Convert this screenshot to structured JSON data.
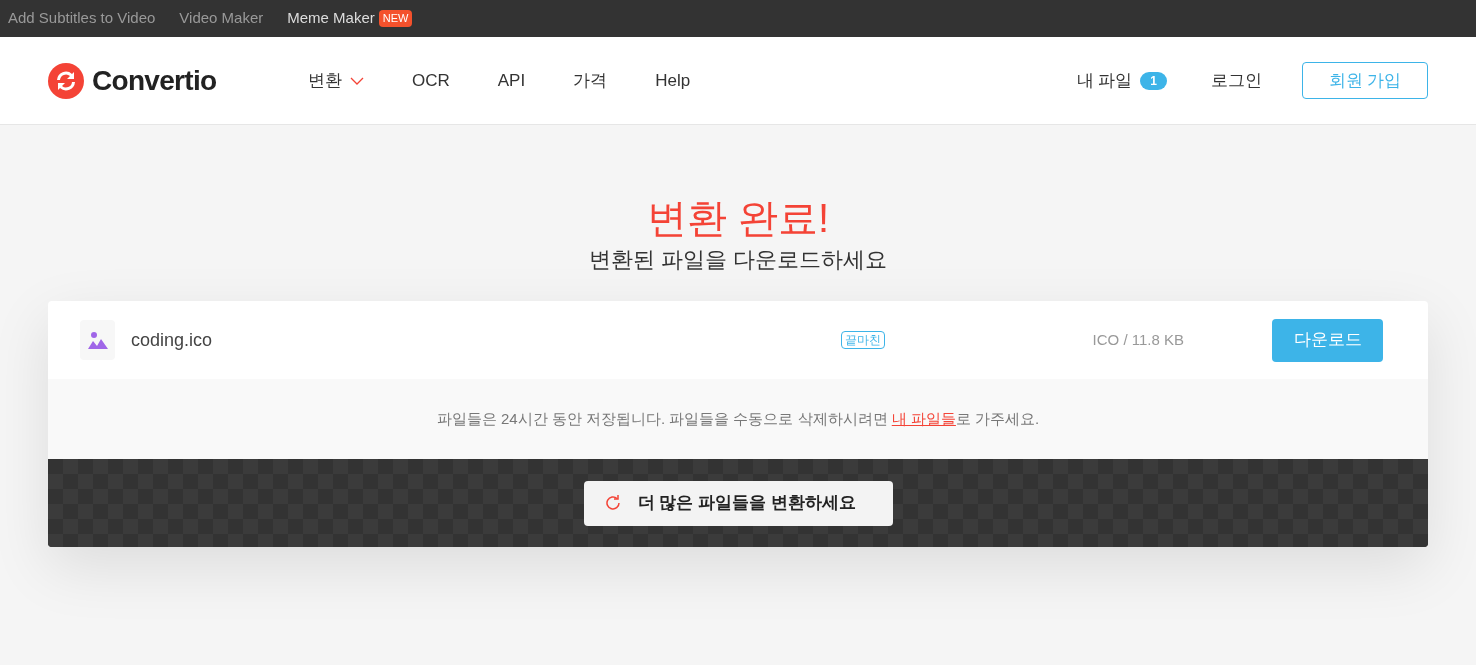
{
  "top_links": [
    {
      "label": "Add Subtitles to Video"
    },
    {
      "label": "Video Maker"
    },
    {
      "label": "Meme Maker",
      "badge": "NEW"
    }
  ],
  "logo": "Convertio",
  "nav": [
    {
      "label": "변환",
      "dropdown": true
    },
    {
      "label": "OCR",
      "dropdown": false
    },
    {
      "label": "API",
      "dropdown": false
    },
    {
      "label": "가격",
      "dropdown": false
    },
    {
      "label": "Help",
      "dropdown": false
    }
  ],
  "my_files": {
    "label": "내 파일",
    "count": "1"
  },
  "login": "로그인",
  "signup": "회원 가입",
  "heading": "변환 완료!",
  "subheading": "변환된 파일을 다운로드하세요",
  "files": [
    {
      "name": "coding.ico",
      "status": "끝마친",
      "info": "ICO / 11.8 KB",
      "action": "다운로드"
    }
  ],
  "notice": {
    "before": "파일들은 24시간 동안 저장됩니다. 파일들을 수동으로 삭제하시려면 ",
    "link": "내 파일들",
    "after": "로 가주세요."
  },
  "convert_more": "더 많은 파일들을 변환하세요"
}
